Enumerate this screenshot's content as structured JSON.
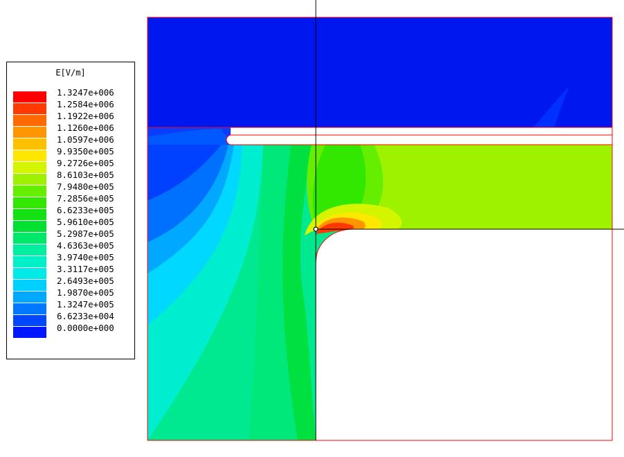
{
  "legend": {
    "title": "E[V/m]",
    "levels": [
      {
        "label": "1.3247e+006",
        "color": "#ff0000"
      },
      {
        "label": "1.2584e+006",
        "color": "#ff3a00"
      },
      {
        "label": "1.1922e+006",
        "color": "#ff6a00"
      },
      {
        "label": "1.1260e+006",
        "color": "#ff9600"
      },
      {
        "label": "1.0597e+006",
        "color": "#ffc000"
      },
      {
        "label": "9.9350e+005",
        "color": "#ffe800"
      },
      {
        "label": "9.2726e+005",
        "color": "#d4f500"
      },
      {
        "label": "8.6103e+005",
        "color": "#9ef200"
      },
      {
        "label": "7.9480e+005",
        "color": "#66ee00"
      },
      {
        "label": "7.2856e+005",
        "color": "#33e800"
      },
      {
        "label": "6.6233e+005",
        "color": "#14e014"
      },
      {
        "label": "5.9610e+005",
        "color": "#00e030"
      },
      {
        "label": "5.2987e+005",
        "color": "#00e86a"
      },
      {
        "label": "4.6363e+005",
        "color": "#00eea0"
      },
      {
        "label": "3.9740e+005",
        "color": "#00f0c8"
      },
      {
        "label": "3.3117e+005",
        "color": "#00eaea"
      },
      {
        "label": "2.6493e+005",
        "color": "#00d0ff"
      },
      {
        "label": "1.9870e+005",
        "color": "#00a8ff"
      },
      {
        "label": "1.3247e+005",
        "color": "#0078ff"
      },
      {
        "label": "6.6233e+004",
        "color": "#0048ff"
      },
      {
        "label": "0.0000e+000",
        "color": "#0018ff"
      }
    ]
  },
  "colors": {
    "boundary": "#ff0000",
    "cursor": "#000000",
    "background": "#ffffff"
  }
}
